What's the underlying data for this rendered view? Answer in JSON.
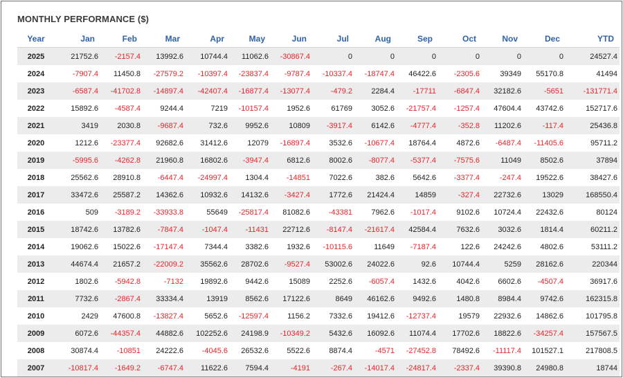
{
  "title": "MONTHLY PERFORMANCE ($)",
  "colors": {
    "header_text": "#2f62a6",
    "negative": "#e8242c",
    "positive": "#222222",
    "stripe": "#ececec"
  },
  "chart_data": {
    "type": "table",
    "title": "MONTHLY PERFORMANCE ($)",
    "columns": [
      "Year",
      "Jan",
      "Feb",
      "Mar",
      "Apr",
      "May",
      "Jun",
      "Jul",
      "Aug",
      "Sep",
      "Oct",
      "Nov",
      "Dec",
      "YTD"
    ],
    "rows": [
      [
        "2025",
        "21752.6",
        "-2157.4",
        "13992.6",
        "10744.4",
        "11062.6",
        "-30867.4",
        "0",
        "0",
        "0",
        "0",
        "0",
        "0",
        "24527.4"
      ],
      [
        "2024",
        "-7907.4",
        "11450.8",
        "-27579.2",
        "-10397.4",
        "-23837.4",
        "-9787.4",
        "-10337.4",
        "-18747.4",
        "46422.6",
        "-2305.6",
        "39349",
        "55170.8",
        "41494"
      ],
      [
        "2023",
        "-6587.4",
        "-41702.8",
        "-14897.4",
        "-42407.4",
        "-16877.4",
        "-13077.4",
        "-479.2",
        "2284.4",
        "-17711",
        "-6847.4",
        "32182.6",
        "-5651",
        "-131771.4"
      ],
      [
        "2022",
        "15892.6",
        "-4587.4",
        "9244.4",
        "7219",
        "-10157.4",
        "1952.6",
        "61769",
        "3052.6",
        "-21757.4",
        "-1257.4",
        "47604.4",
        "43742.6",
        "152717.6"
      ],
      [
        "2021",
        "3419",
        "2030.8",
        "-9687.4",
        "732.6",
        "9952.6",
        "10809",
        "-3917.4",
        "6142.6",
        "-4777.4",
        "-352.8",
        "11202.6",
        "-117.4",
        "25436.8"
      ],
      [
        "2020",
        "1212.6",
        "-23377.4",
        "92682.6",
        "31412.6",
        "12079",
        "-16897.4",
        "3532.6",
        "-10677.4",
        "18764.4",
        "4872.6",
        "-6487.4",
        "-11405.6",
        "95711.2"
      ],
      [
        "2019",
        "-5995.6",
        "-4262.8",
        "21960.8",
        "16802.6",
        "-3947.4",
        "6812.6",
        "8002.6",
        "-8077.4",
        "-5377.4",
        "-7575.6",
        "11049",
        "8502.6",
        "37894"
      ],
      [
        "2018",
        "25562.6",
        "28910.8",
        "-6447.4",
        "-24997.4",
        "1304.4",
        "-14851",
        "7022.6",
        "382.6",
        "5642.6",
        "-3377.4",
        "-247.4",
        "19522.6",
        "38427.6"
      ],
      [
        "2017",
        "33472.6",
        "25587.2",
        "14362.6",
        "10932.6",
        "14132.6",
        "-3427.4",
        "1772.6",
        "21424.4",
        "14859",
        "-327.4",
        "22732.6",
        "13029",
        "168550.4"
      ],
      [
        "2016",
        "509",
        "-3189.2",
        "-33933.8",
        "55649",
        "-25817.4",
        "81082.6",
        "-43381",
        "7962.6",
        "-1017.4",
        "9102.6",
        "10724.4",
        "22432.6",
        "80124"
      ],
      [
        "2015",
        "18742.6",
        "13782.6",
        "-7847.4",
        "-1047.4",
        "-11431",
        "22712.6",
        "-8147.4",
        "-21617.4",
        "42584.4",
        "7632.6",
        "3032.6",
        "1814.4",
        "60211.2"
      ],
      [
        "2014",
        "19062.6",
        "15022.6",
        "-17147.4",
        "7344.4",
        "3382.6",
        "1932.6",
        "-10115.6",
        "11649",
        "-7187.4",
        "122.6",
        "24242.6",
        "4802.6",
        "53111.2"
      ],
      [
        "2013",
        "44674.4",
        "21657.2",
        "-22009.2",
        "35562.6",
        "28702.6",
        "-9527.4",
        "53002.6",
        "24022.6",
        "92.6",
        "10744.4",
        "5259",
        "28162.6",
        "220344"
      ],
      [
        "2012",
        "1802.6",
        "-5942.8",
        "-7132",
        "19892.6",
        "9442.6",
        "15089",
        "2252.6",
        "-6057.4",
        "1432.6",
        "4042.6",
        "6602.6",
        "-4507.4",
        "36917.6"
      ],
      [
        "2011",
        "7732.6",
        "-2867.4",
        "33334.4",
        "13919",
        "8562.6",
        "17122.6",
        "8649",
        "46162.6",
        "9492.6",
        "1480.8",
        "8984.4",
        "9742.6",
        "162315.8"
      ],
      [
        "2010",
        "2429",
        "47600.8",
        "-13827.4",
        "5652.6",
        "-12597.4",
        "1156.2",
        "7332.6",
        "19412.6",
        "-12737.4",
        "19579",
        "22932.6",
        "14862.6",
        "101795.8"
      ],
      [
        "2009",
        "6072.6",
        "-44357.4",
        "44882.6",
        "102252.6",
        "24198.9",
        "-10349.2",
        "5432.6",
        "16092.6",
        "11074.4",
        "17702.6",
        "18822.6",
        "-34257.4",
        "157567.5"
      ],
      [
        "2008",
        "30874.4",
        "-10851",
        "24222.6",
        "-4045.6",
        "26532.6",
        "5522.6",
        "8874.4",
        "-4571",
        "-27452.8",
        "78492.6",
        "-11117.4",
        "101527.1",
        "217808.5"
      ],
      [
        "2007",
        "-10817.4",
        "-1649.2",
        "-6747.4",
        "11622.6",
        "7594.4",
        "-4191",
        "-267.4",
        "-14017.4",
        "-24817.4",
        "-2337.4",
        "39390.8",
        "24980.8",
        "18744"
      ]
    ]
  }
}
